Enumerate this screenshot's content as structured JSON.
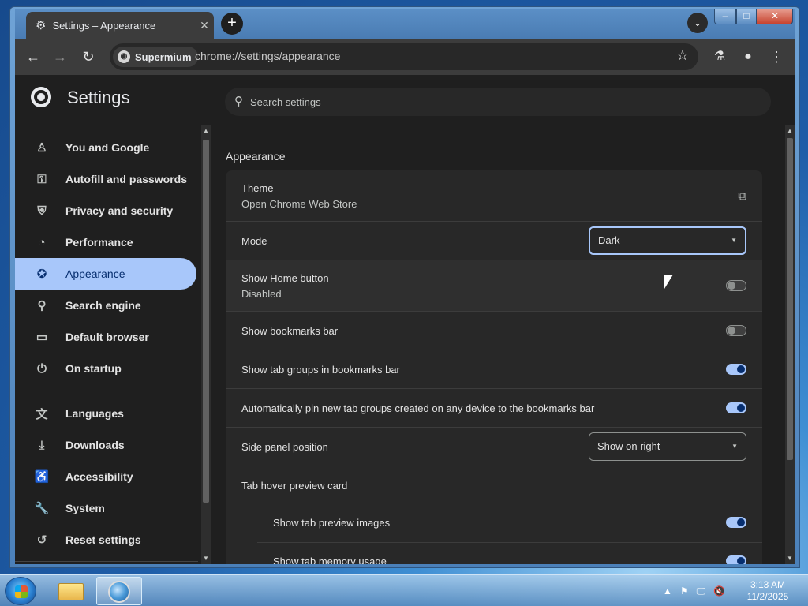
{
  "tab": {
    "title": "Settings – Appearance",
    "close_glyph": "✕",
    "new_tab_glyph": "+"
  },
  "window": {
    "minimize": "–",
    "maximize": "□",
    "close": "✕"
  },
  "toolbar": {
    "back_glyph": "←",
    "forward_glyph": "→",
    "reload_glyph": "↻",
    "site_chip": "Supermium",
    "url": "chrome://settings/appearance",
    "star_glyph": "☆",
    "labs_glyph": "⚗",
    "profile_glyph": "●",
    "menu_glyph": "⋮"
  },
  "settings": {
    "title": "Settings",
    "search_placeholder": "Search settings"
  },
  "sidebar": {
    "items": [
      {
        "label": "You and Google",
        "icon": "person-icon",
        "glyph": "♙"
      },
      {
        "label": "Autofill and passwords",
        "icon": "key-icon",
        "glyph": "⚿"
      },
      {
        "label": "Privacy and security",
        "icon": "shield-icon",
        "glyph": "⛨"
      },
      {
        "label": "Performance",
        "icon": "speedometer-icon",
        "glyph": "◔"
      },
      {
        "label": "Appearance",
        "icon": "palette-icon",
        "glyph": "✪"
      },
      {
        "label": "Search engine",
        "icon": "search-icon",
        "glyph": "⚲"
      },
      {
        "label": "Default browser",
        "icon": "browser-icon",
        "glyph": "▭"
      },
      {
        "label": "On startup",
        "icon": "power-icon",
        "glyph": "⏻"
      },
      {
        "label": "Languages",
        "icon": "translate-icon",
        "glyph": "文"
      },
      {
        "label": "Downloads",
        "icon": "download-icon",
        "glyph": "⤓"
      },
      {
        "label": "Accessibility",
        "icon": "accessibility-icon",
        "glyph": "♿"
      },
      {
        "label": "System",
        "icon": "wrench-icon",
        "glyph": "🔧"
      },
      {
        "label": "Reset settings",
        "icon": "reset-icon",
        "glyph": "↺"
      }
    ],
    "active_index": 4
  },
  "main": {
    "section_title": "Appearance",
    "theme": {
      "label": "Theme",
      "sub": "Open Chrome Web Store",
      "icon": "external-link-icon",
      "glyph": "⧉"
    },
    "mode": {
      "label": "Mode",
      "value": "Dark"
    },
    "home_button": {
      "label": "Show Home button",
      "sub": "Disabled",
      "enabled": false
    },
    "bookmarks_bar": {
      "label": "Show bookmarks bar",
      "enabled": false
    },
    "tab_groups": {
      "label": "Show tab groups in bookmarks bar",
      "enabled": true
    },
    "auto_pin": {
      "label": "Automatically pin new tab groups created on any device to the bookmarks bar",
      "enabled": true
    },
    "side_panel": {
      "label": "Side panel position",
      "value": "Show on right"
    },
    "hover_card": {
      "label": "Tab hover preview card"
    },
    "preview_images": {
      "label": "Show tab preview images",
      "enabled": true
    },
    "memory_usage": {
      "label": "Show tab memory usage",
      "enabled": true
    }
  },
  "taskbar": {
    "time": "3:13 AM",
    "date": "11/2/2025",
    "tray": [
      "▲",
      "⚑",
      "🖵",
      "🔇"
    ]
  },
  "colors": {
    "accent": "#a8c7fa",
    "surface": "#282828",
    "background": "#1f1f1f"
  }
}
